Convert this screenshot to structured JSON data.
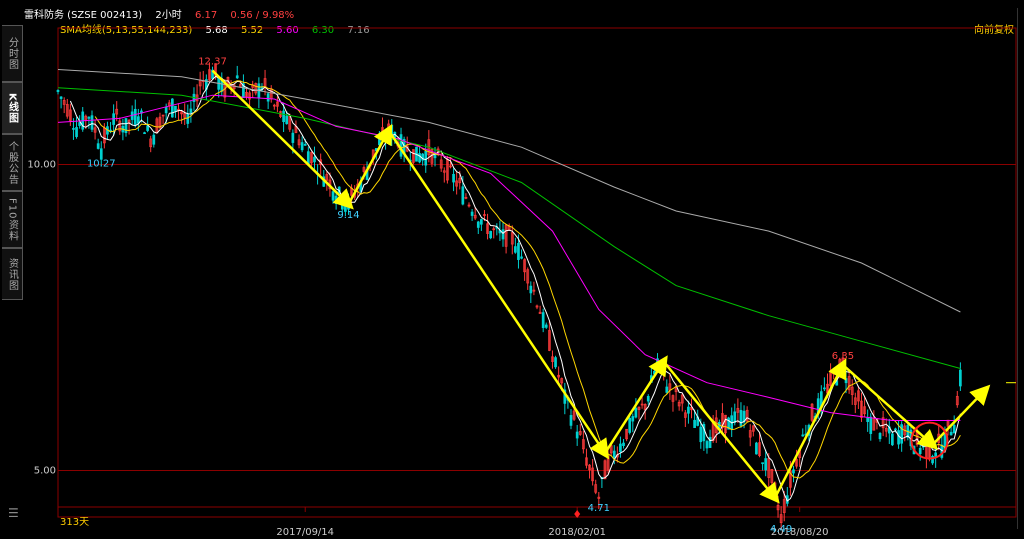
{
  "header": {
    "name_code": "雷科防务 (SZSE 002413)",
    "period": "2小时",
    "price": "6.17",
    "change": "0.56 / 9.98%"
  },
  "sidebar": {
    "tabs": [
      {
        "label": "分时图",
        "active": false
      },
      {
        "label": "K线图",
        "active": true
      },
      {
        "label": "个股公告",
        "active": false
      },
      {
        "label": "F10资料",
        "active": false
      },
      {
        "label": "资讯图",
        "active": false
      }
    ]
  },
  "sma": {
    "label": "SMA均线(5,13,55,144,233)",
    "values": [
      "5.68",
      "5.52",
      "5.60",
      "6.30",
      "7.16"
    ],
    "colors": [
      "#ffffff",
      "#ffd700",
      "#ff00ff",
      "#00c000",
      "#999999"
    ]
  },
  "adjust_label": "向前复权",
  "days_label": "313天",
  "chart_data": {
    "type": "candlestick",
    "ylim": [
      4.5,
      13.5
    ],
    "ylog": true,
    "y_ticks": [
      "10.00",
      "5.00"
    ],
    "x_ticks": [
      "2017/09/14",
      "2018/02/01",
      "2018/08/20"
    ],
    "annotations": [
      "12.37",
      "10.27",
      "9.14",
      "4.71",
      "4.49",
      "6.35"
    ],
    "price_path": [
      [
        0,
        11.8
      ],
      [
        6,
        10.9
      ],
      [
        10,
        11.2
      ],
      [
        14,
        10.4
      ],
      [
        18,
        11.1
      ],
      [
        22,
        10.9
      ],
      [
        26,
        11.3
      ],
      [
        30,
        10.6
      ],
      [
        34,
        11.2
      ],
      [
        38,
        11.5
      ],
      [
        42,
        11.0
      ],
      [
        46,
        12.0
      ],
      [
        50,
        12.37
      ],
      [
        54,
        11.8
      ],
      [
        58,
        12.2
      ],
      [
        62,
        11.6
      ],
      [
        66,
        12.0
      ],
      [
        70,
        11.4
      ],
      [
        74,
        11.0
      ],
      [
        78,
        10.6
      ],
      [
        82,
        10.2
      ],
      [
        86,
        9.8
      ],
      [
        90,
        9.4
      ],
      [
        94,
        9.14
      ],
      [
        97,
        9.5
      ],
      [
        100,
        9.9
      ],
      [
        104,
        10.5
      ],
      [
        108,
        10.8
      ],
      [
        112,
        10.4
      ],
      [
        116,
        10.2
      ],
      [
        120,
        10.3
      ],
      [
        124,
        10.0
      ],
      [
        128,
        9.7
      ],
      [
        132,
        9.3
      ],
      [
        136,
        8.9
      ],
      [
        140,
        8.6
      ],
      [
        144,
        8.5
      ],
      [
        148,
        8.4
      ],
      [
        152,
        7.8
      ],
      [
        156,
        7.2
      ],
      [
        160,
        6.5
      ],
      [
        164,
        5.9
      ],
      [
        168,
        5.5
      ],
      [
        172,
        5.0
      ],
      [
        175,
        4.71
      ],
      [
        178,
        5.1
      ],
      [
        182,
        5.3
      ],
      [
        186,
        5.6
      ],
      [
        190,
        5.8
      ],
      [
        194,
        6.4
      ],
      [
        198,
        6.0
      ],
      [
        202,
        5.8
      ],
      [
        206,
        5.6
      ],
      [
        210,
        5.4
      ],
      [
        214,
        5.5
      ],
      [
        218,
        5.6
      ],
      [
        222,
        5.7
      ],
      [
        226,
        5.3
      ],
      [
        230,
        5.0
      ],
      [
        234,
        4.49
      ],
      [
        238,
        5.0
      ],
      [
        242,
        5.5
      ],
      [
        246,
        5.8
      ],
      [
        250,
        6.1
      ],
      [
        254,
        6.35
      ],
      [
        258,
        5.9
      ],
      [
        262,
        5.6
      ],
      [
        266,
        5.5
      ],
      [
        270,
        5.4
      ],
      [
        274,
        5.5
      ],
      [
        278,
        5.3
      ],
      [
        282,
        5.2
      ],
      [
        286,
        5.3
      ],
      [
        290,
        5.6
      ],
      [
        292,
        6.17
      ]
    ],
    "ma_lines": [
      {
        "name": "SMA233",
        "color": "#aaaaaa",
        "points": [
          [
            0,
            12.4
          ],
          [
            40,
            12.2
          ],
          [
            80,
            11.6
          ],
          [
            120,
            11.0
          ],
          [
            150,
            10.4
          ],
          [
            180,
            9.5
          ],
          [
            200,
            9.0
          ],
          [
            230,
            8.6
          ],
          [
            260,
            8.0
          ],
          [
            292,
            7.16
          ]
        ]
      },
      {
        "name": "SMA144",
        "color": "#00c000",
        "points": [
          [
            0,
            11.9
          ],
          [
            40,
            11.7
          ],
          [
            80,
            11.1
          ],
          [
            120,
            10.4
          ],
          [
            150,
            9.6
          ],
          [
            180,
            8.3
          ],
          [
            200,
            7.6
          ],
          [
            230,
            7.1
          ],
          [
            260,
            6.7
          ],
          [
            292,
            6.3
          ]
        ]
      },
      {
        "name": "SMA55",
        "color": "#ff00ff",
        "points": [
          [
            0,
            11.0
          ],
          [
            20,
            11.1
          ],
          [
            50,
            11.7
          ],
          [
            70,
            11.6
          ],
          [
            90,
            10.9
          ],
          [
            110,
            10.6
          ],
          [
            140,
            9.8
          ],
          [
            160,
            8.6
          ],
          [
            175,
            7.2
          ],
          [
            190,
            6.5
          ],
          [
            210,
            6.1
          ],
          [
            230,
            5.9
          ],
          [
            250,
            5.7
          ],
          [
            270,
            5.6
          ],
          [
            292,
            5.6
          ]
        ]
      }
    ]
  },
  "trend_lines": [
    [
      [
        50,
        12.37
      ],
      [
        94,
        9.14
      ]
    ],
    [
      [
        94,
        9.14
      ],
      [
        107,
        10.8
      ]
    ],
    [
      [
        107,
        10.8
      ],
      [
        177,
        5.2
      ]
    ],
    [
      [
        177,
        5.2
      ],
      [
        196,
        6.4
      ]
    ],
    [
      [
        196,
        6.4
      ],
      [
        232,
        4.7
      ]
    ],
    [
      [
        232,
        4.7
      ],
      [
        254,
        6.35
      ]
    ],
    [
      [
        254,
        6.35
      ],
      [
        283,
        5.3
      ]
    ],
    [
      [
        283,
        5.3
      ],
      [
        300,
        6.0
      ]
    ]
  ]
}
